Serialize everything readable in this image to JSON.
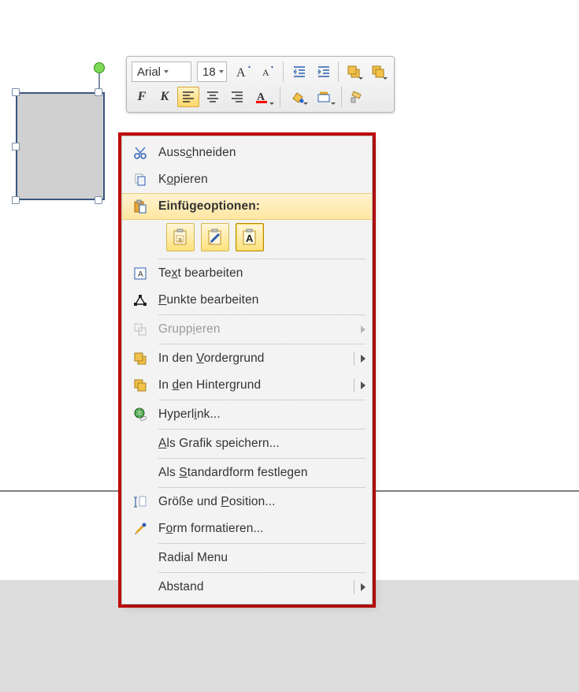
{
  "toolbar": {
    "font": "Arial",
    "size": "18"
  },
  "menu": {
    "cut": {
      "pre": "Auss",
      "u": "c",
      "post": "hneiden"
    },
    "copy": {
      "pre": "K",
      "u": "o",
      "post": "pieren"
    },
    "paste_options": "Einfügeoptionen:",
    "edit_text": {
      "pre": "Te",
      "u": "x",
      "post": "t bearbeiten"
    },
    "edit_points": {
      "u": "P",
      "post": "unkte bearbeiten"
    },
    "group": {
      "pre": "Grupp",
      "u": "i",
      "post": "eren"
    },
    "front": {
      "pre": "In den ",
      "u": "V",
      "post": "ordergrund"
    },
    "back": {
      "pre": "In ",
      "u": "d",
      "post": "en Hintergrund"
    },
    "hyperlink": {
      "pre": "Hyperl",
      "u": "i",
      "post": "nk..."
    },
    "save_pic": {
      "u": "A",
      "post": "ls Grafik speichern..."
    },
    "default_shape": {
      "pre": "Als ",
      "u": "S",
      "post": "tandardform festlegen"
    },
    "size_pos": {
      "pre": "Größe und ",
      "u": "P",
      "post": "osition..."
    },
    "format_shape": {
      "pre": "F",
      "u": "o",
      "post": "rm formatieren..."
    },
    "radial": "Radial Menu",
    "spacing": "Abstand"
  }
}
